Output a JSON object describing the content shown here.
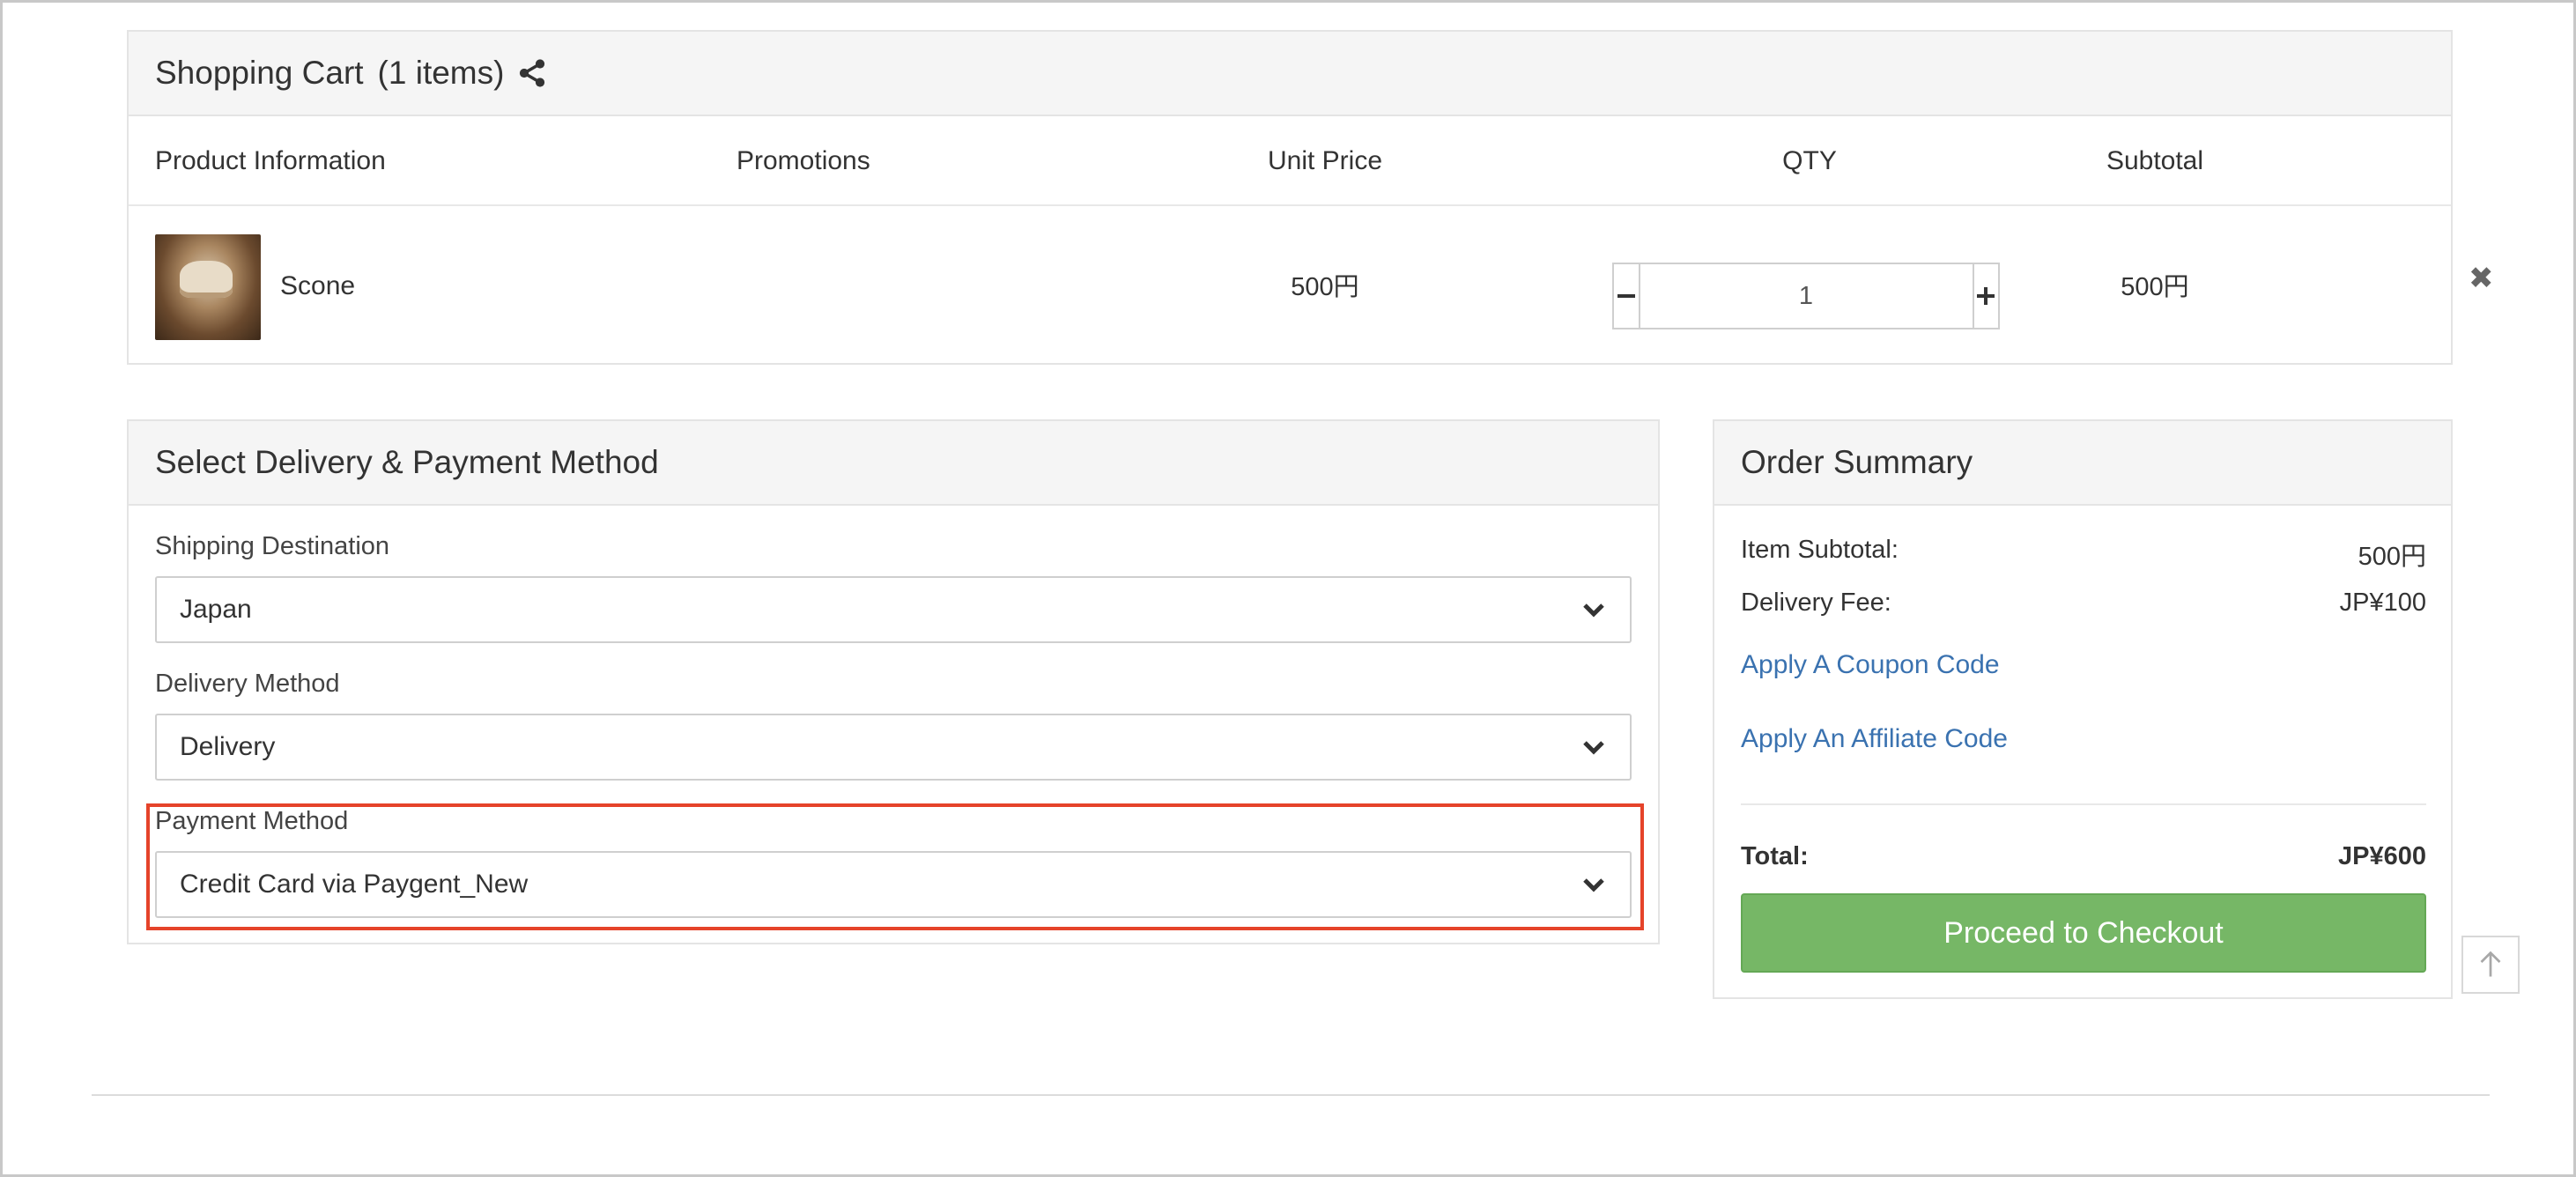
{
  "cart": {
    "title": "Shopping Cart",
    "count_label": "(1 items)",
    "columns": {
      "product_info": "Product Information",
      "promotions": "Promotions",
      "unit_price": "Unit Price",
      "qty": "QTY",
      "subtotal": "Subtotal"
    },
    "items": [
      {
        "name": "Scone",
        "unit_price": "500円",
        "quantity": "1",
        "subtotal": "500円"
      }
    ],
    "icons": {
      "share": "share-icon",
      "remove": "close-icon",
      "decrease": "minus-icon",
      "increase": "plus-icon"
    }
  },
  "delivery": {
    "title": "Select Delivery & Payment Method",
    "shipping_label": "Shipping Destination",
    "shipping_value": "Japan",
    "method_label": "Delivery Method",
    "method_value": "Delivery",
    "payment_label": "Payment Method",
    "payment_value": "Credit Card via Paygent_New"
  },
  "summary": {
    "title": "Order Summary",
    "item_subtotal_label": "Item Subtotal:",
    "item_subtotal_value": "500円",
    "delivery_fee_label": "Delivery Fee:",
    "delivery_fee_value": "JP¥100",
    "coupon_link": "Apply A Coupon Code",
    "affiliate_link": "Apply An Affiliate Code",
    "total_label": "Total:",
    "total_value": "JP¥600",
    "checkout_button": "Proceed to Checkout"
  },
  "colors": {
    "checkout_green": "#76b766",
    "link_blue": "#3a72b0",
    "highlight_red": "#e5432a",
    "panel_header_bg": "#f5f5f5"
  }
}
